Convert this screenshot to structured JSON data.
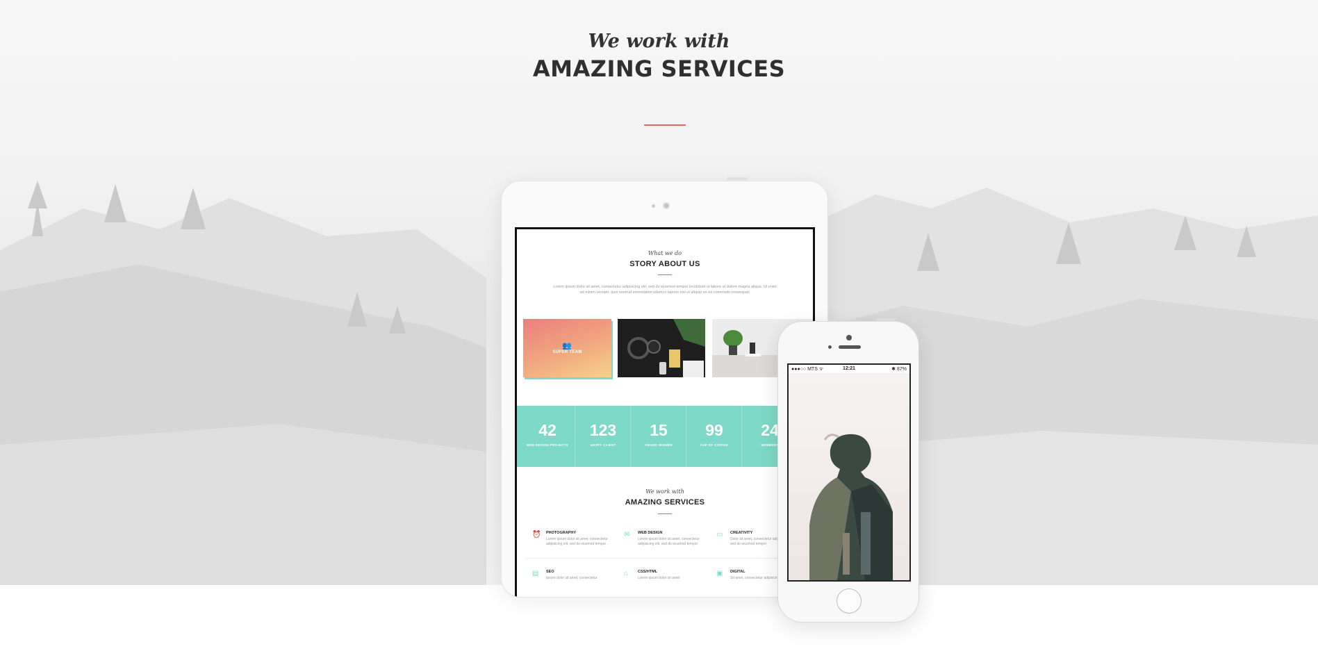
{
  "header": {
    "kicker": "We work with",
    "title": "AMAZING SERVICES",
    "accent_color": "#e8675e"
  },
  "tablet_screen": {
    "about": {
      "kicker": "What we do",
      "title": "STORY ABOUT US",
      "text": "Lorem ipsum dolor sit amet, consectetur adipisicing elit, sed do eiusmod tempor incididunt ut labore et dolore magna aliqua. Ut enim ad minim veniam, quis nostrud exercitation ullamco laboris nisi ut aliquip ex ea commodo consequat."
    },
    "gallery": {
      "first_label": "SUPER TEAM",
      "first_icon": "users-icon"
    },
    "counters": [
      {
        "number": "42",
        "label": "WEB DESIGN PROJECTS"
      },
      {
        "number": "123",
        "label": "HAPPY CLIENT"
      },
      {
        "number": "15",
        "label": "AWARD WINNER"
      },
      {
        "number": "99",
        "label": "CUP OF COFFEE"
      },
      {
        "number": "24",
        "label": "MEMBERS"
      }
    ],
    "services": {
      "kicker": "We work with",
      "title": "AMAZING SERVICES",
      "items": [
        {
          "icon": "alarm-icon",
          "title": "PHOTOGRAPHY",
          "text": "Lorem ipsum dolor sit amet, consectetur adipisicing elit, sed do eiusmod tempor"
        },
        {
          "icon": "inbox-icon",
          "title": "WEB DESIGN",
          "text": "Lorem ipsum dolor sit amet, consectetur adipisicing elit, sed do eiusmod tempor"
        },
        {
          "icon": "monitor-icon",
          "title": "CREATIVITY",
          "text": "Dolor sit amet, consectetur adipisicing elit, sed do eiusmod tempor"
        },
        {
          "icon": "book-icon",
          "title": "SEO",
          "text": "Ipsum dolor sit amet, consectetur"
        },
        {
          "icon": "home-icon",
          "title": "CSS/HTML",
          "text": "Lorem ipsum dolor sit amet"
        },
        {
          "icon": "grid-icon",
          "title": "DIGITAL",
          "text": "Sit amet, consectetur adipisicing"
        }
      ]
    },
    "accent_color": "#7fd9c8"
  },
  "phone_screen": {
    "carrier": "●●●○○ MTS ᯤ",
    "time": "12:21",
    "battery": "✱ 87%"
  }
}
